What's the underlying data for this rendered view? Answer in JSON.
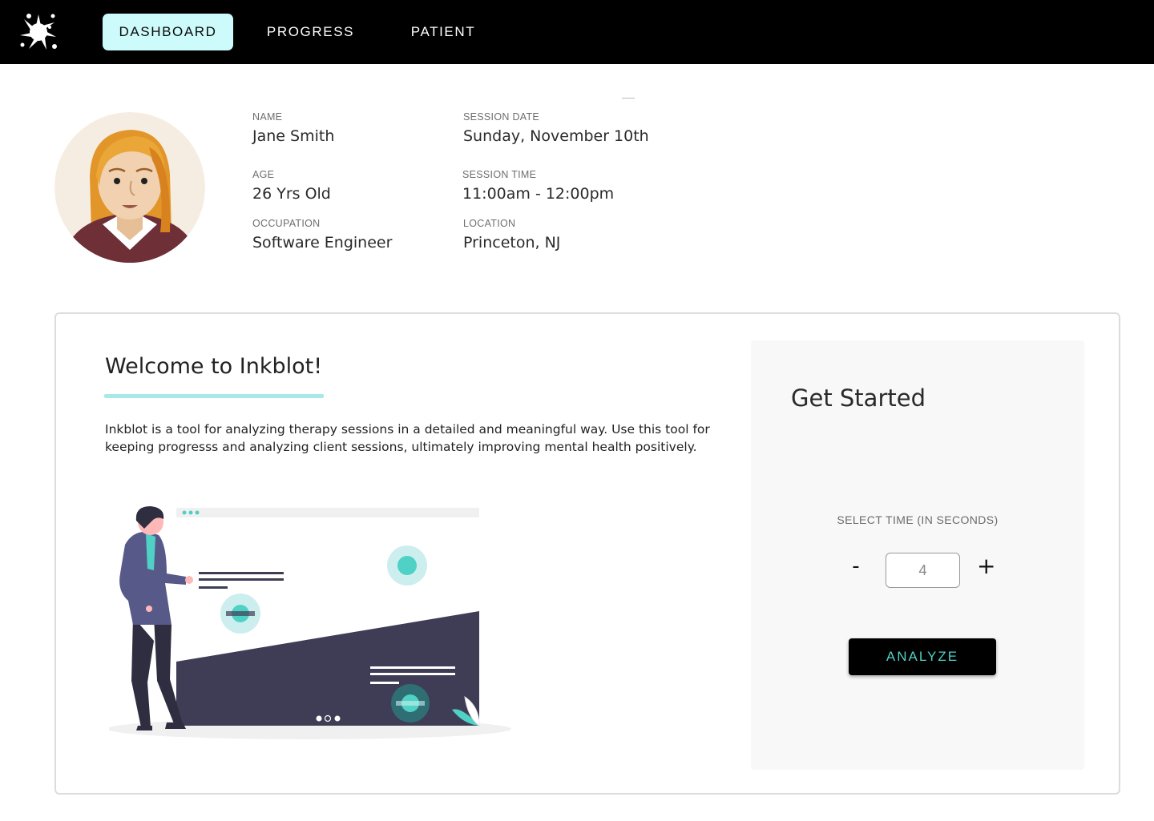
{
  "nav": {
    "tabs": [
      {
        "label": "DASHBOARD",
        "active": true
      },
      {
        "label": "PROGRESS",
        "active": false
      },
      {
        "label": "PATIENT",
        "active": false
      }
    ],
    "logo_icon": "ink-splat-icon"
  },
  "patient": {
    "name_label": "NAME",
    "name": "Jane Smith",
    "age_label": "AGE",
    "age": "26 Yrs Old",
    "occupation_label": "OCCUPATION",
    "occupation": "Software Engineer",
    "session_date_label": "SESSION DATE",
    "session_date": "Sunday, November 10th",
    "session_time_label": "SESSION TIME",
    "session_time": "11:00am - 12:00pm",
    "location_label": "LOCATION",
    "location": "Princeton, NJ"
  },
  "welcome": {
    "title": "Welcome to Inkblot!",
    "description": "Inkblot is a tool for analyzing therapy sessions in a detailed and meaningful way. Use this tool for keeping progresss and analyzing client sessions, ultimately improving mental health positively."
  },
  "get_started": {
    "title": "Get Started",
    "select_label": "SELECT TIME (IN SECONDS)",
    "minus": "-",
    "plus": "+",
    "time_value": "4",
    "analyze_label": "ANALYZE"
  },
  "colors": {
    "nav_bg": "#000000",
    "active_tab_bg": "#cdfafa",
    "accent_teal": "#4fd1c5",
    "underline": "#a8e8e8",
    "illustration_dark": "#3f3d56"
  }
}
